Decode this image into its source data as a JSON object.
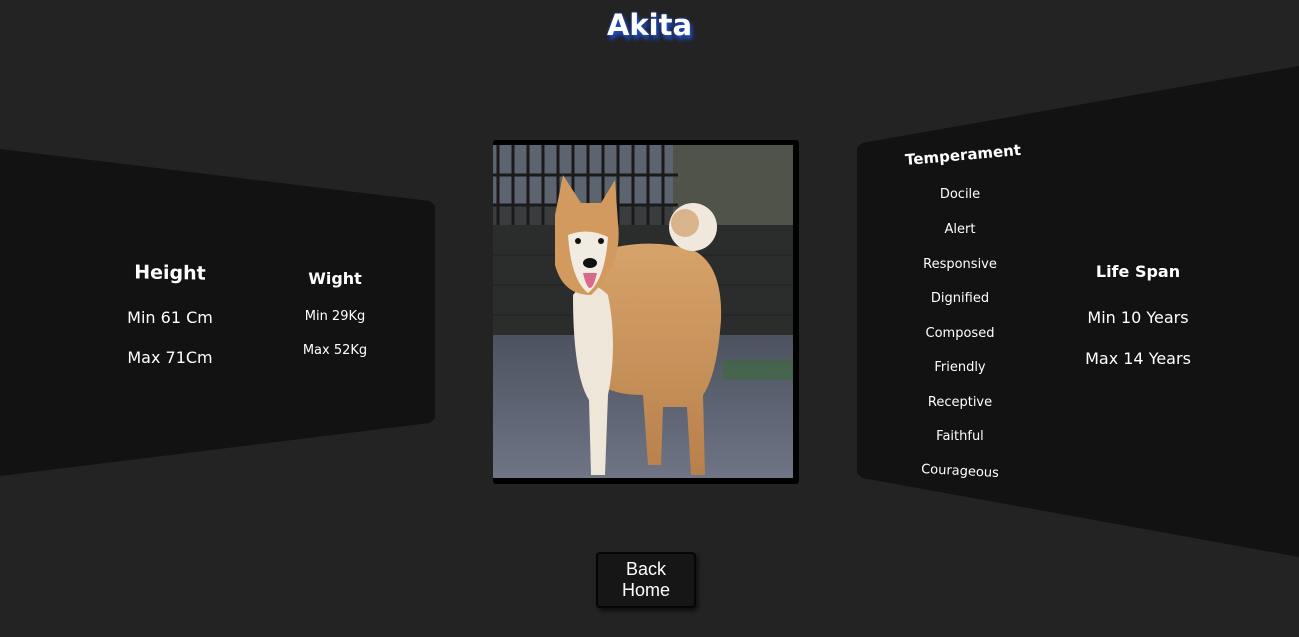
{
  "breed": {
    "name": "Akita"
  },
  "height": {
    "title": "Height",
    "min": "Min 61 Cm",
    "max": "Max 71Cm"
  },
  "weight": {
    "title": "Wight",
    "min": "Min 29Kg",
    "max": "Max 52Kg"
  },
  "temperament": {
    "title": "Temperament",
    "items": [
      "Docile",
      "Alert",
      "Responsive",
      "Dignified",
      "Composed",
      "Friendly",
      "Receptive",
      "Faithful",
      "Courageous"
    ]
  },
  "life_span": {
    "title": "Life Span",
    "min": "Min 10 Years",
    "max": "Max 14 Years"
  },
  "photo": {
    "icon": "dog-photo"
  },
  "actions": {
    "back_home_label": "Back Home"
  },
  "colors": {
    "background": "#232323",
    "panel": "#121212",
    "title_glow": "#1e4fd0"
  }
}
